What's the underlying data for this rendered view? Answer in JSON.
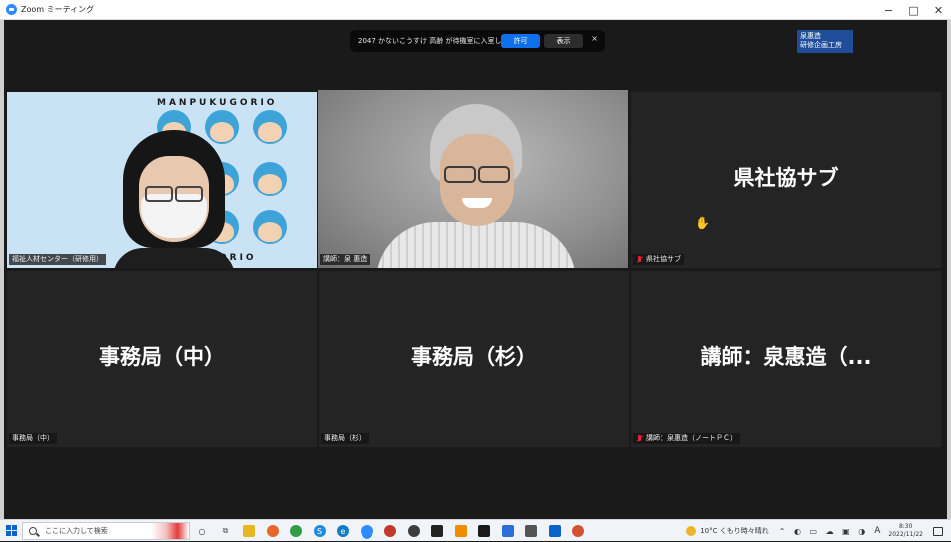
{
  "window": {
    "title": "Zoom ミーティング",
    "controls": {
      "minimize": "−",
      "maximize": "□",
      "close": "✕"
    }
  },
  "notification": {
    "message": "2047 かないこうすけ  高齢 が待機室に入室しました",
    "allow_label": "許可",
    "show_label": "表示",
    "close_label": "×"
  },
  "watermark": {
    "line1": "泉惠造",
    "line2": "研修企画工房"
  },
  "tiles": [
    {
      "tag": "福祉人材センター（研修用）",
      "big": "",
      "muted": false,
      "active": false,
      "banner": "MANPUKUGORIO"
    },
    {
      "tag": "講師：泉 惠造",
      "big": "",
      "muted": false,
      "active": true
    },
    {
      "tag": "県社協サブ",
      "big": "県社協サブ",
      "muted": true,
      "active": false
    },
    {
      "tag": "事務局（中）",
      "big": "事務局（中）",
      "muted": false,
      "active": false
    },
    {
      "tag": "事務局（杉）",
      "big": "事務局（杉）",
      "muted": false,
      "active": false
    },
    {
      "tag": "講師：泉惠造（ノートＰＣ）",
      "big": "講師：泉惠造（...",
      "muted": true,
      "active": false
    }
  ],
  "taskbar": {
    "search_placeholder": "ここに入力して検索",
    "weather": "10°C  くもり時々晴れ",
    "ime": "A",
    "time": "8:30",
    "date": "2022/11/22",
    "apps": [
      {
        "name": "cortana-icon",
        "color": "#333333",
        "glyph": "○"
      },
      {
        "name": "task-view-icon",
        "color": "#555555",
        "glyph": "⧉"
      },
      {
        "name": "file-explorer-icon",
        "color": "#e8b523",
        "glyph": ""
      },
      {
        "name": "firefox-icon",
        "color": "#e8662a",
        "glyph": ""
      },
      {
        "name": "chrome-icon",
        "color": "#2f9e44",
        "glyph": ""
      },
      {
        "name": "skype-icon",
        "color": "#1c8de0",
        "glyph": "S"
      },
      {
        "name": "edge-icon",
        "color": "#0f7dc8",
        "glyph": "e"
      },
      {
        "name": "zoom-icon",
        "color": "#2D8CFF",
        "glyph": ""
      },
      {
        "name": "red-app-icon",
        "color": "#c0392b",
        "glyph": ""
      },
      {
        "name": "globe-app-icon",
        "color": "#3d3d3d",
        "glyph": ""
      },
      {
        "name": "dark-app-icon",
        "color": "#222222",
        "glyph": ""
      },
      {
        "name": "orange-app-icon",
        "color": "#f08c00",
        "glyph": ""
      },
      {
        "name": "terminal-icon",
        "color": "#1b1b1b",
        "glyph": ""
      },
      {
        "name": "photos-icon",
        "color": "#2c6ed5",
        "glyph": ""
      },
      {
        "name": "camera-icon",
        "color": "#555555",
        "glyph": ""
      },
      {
        "name": "outlook-icon",
        "color": "#0a64c8",
        "glyph": ""
      },
      {
        "name": "powerpoint-icon",
        "color": "#d35230",
        "glyph": ""
      }
    ]
  },
  "colors": {
    "accent": "#2D8CFF",
    "allow_button": "#0E71EB",
    "active_speaker": "#b9d84a",
    "mic_muted": "#e02828",
    "tile_bg": "#242424"
  }
}
